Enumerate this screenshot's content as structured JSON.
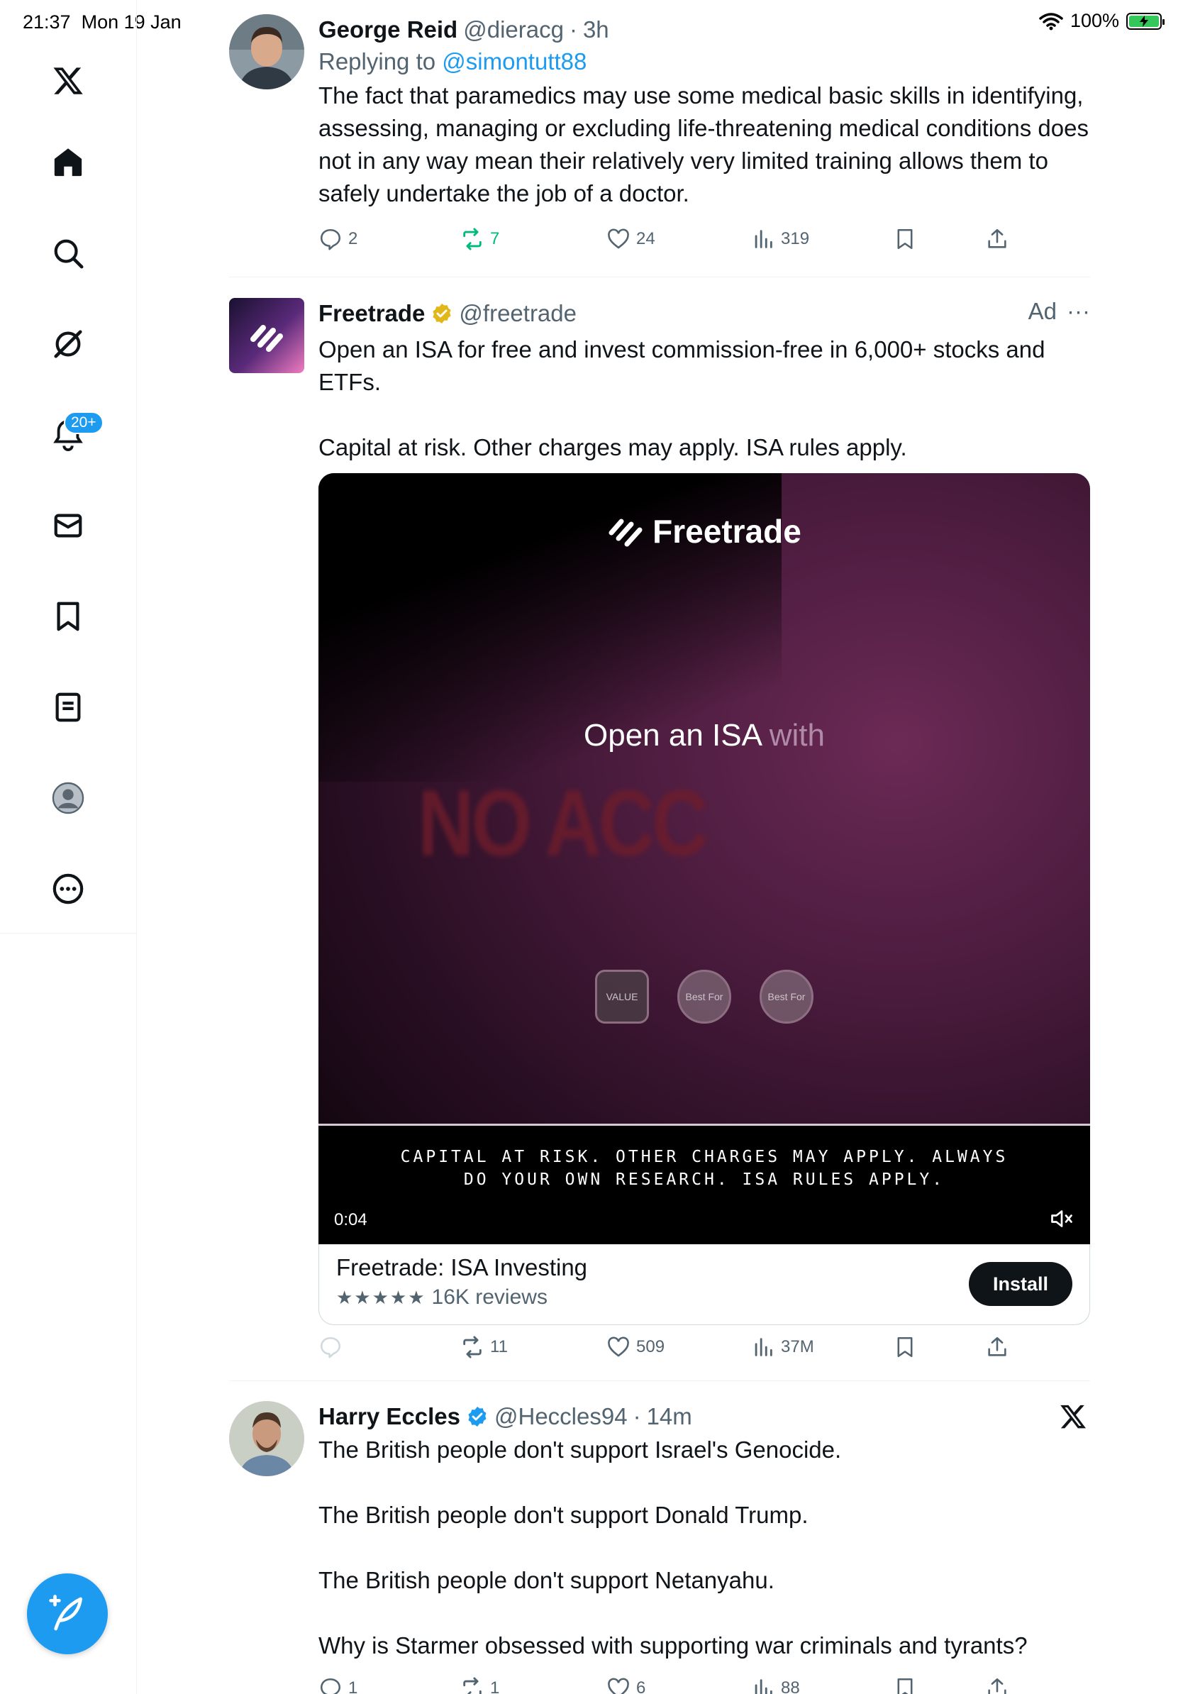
{
  "status_bar": {
    "time": "21:37",
    "date": "Mon 19 Jan",
    "battery": "100%"
  },
  "sidebar": {
    "items": [
      {
        "name": "x-logo"
      },
      {
        "name": "home"
      },
      {
        "name": "search"
      },
      {
        "name": "grok"
      },
      {
        "name": "notifications",
        "badge": "20+"
      },
      {
        "name": "messages"
      },
      {
        "name": "bookmarks"
      },
      {
        "name": "lists"
      },
      {
        "name": "profile"
      },
      {
        "name": "more"
      }
    ]
  },
  "tweets": [
    {
      "name": "George Reid",
      "handle": "@dieracg",
      "time": "3h",
      "reply_prefix": "Replying to",
      "reply_handle": "@simontutt88",
      "text": "The fact that paramedics may use some medical basic skills in identifying, assessing, managing or excluding life-threatening medical conditions does not in any way mean their relatively very limited training allows them to safely undertake the job of a doctor.",
      "stats": {
        "replies": "2",
        "retweets": "7",
        "likes": "24",
        "views": "319"
      }
    },
    {
      "name": "Freetrade",
      "handle": "@freetrade",
      "ad_label": "Ad",
      "more_label": "···",
      "text": "Open an ISA for free and invest commission-free in 6,000+ stocks and ETFs.\n\nCapital at risk. Other charges may apply. ISA rules apply.",
      "video": {
        "logo_text": "Freetrade",
        "tagline_main": "Open an ISA ",
        "tagline_faded": "with",
        "big_text": "NO ACC",
        "badge_labels": [
          "VALUE",
          "Best For",
          "Best For"
        ],
        "disclaimer_line1": "CAPITAL AT RISK. OTHER CHARGES MAY APPLY. ALWAYS",
        "disclaimer_line2": "DO YOUR OWN RESEARCH. ISA RULES APPLY.",
        "time": "0:04"
      },
      "card": {
        "app_name": "Freetrade: ISA Investing",
        "stars": "★★★★★",
        "rating": 4.5,
        "reviews": "16K reviews",
        "install_label": "Install"
      },
      "stats": {
        "retweets": "11",
        "likes": "509",
        "views": "37M"
      }
    },
    {
      "name": "Harry Eccles",
      "handle": "@Heccles94",
      "time": "14m",
      "text": "The British people don't support Israel's Genocide.\n\nThe British people don't support Donald Trump.\n\nThe British people don't support Netanyahu.\n\nWhy is Starmer obsessed with supporting war criminals and tyrants?",
      "stats": {
        "replies": "1",
        "retweets": "1",
        "likes": "6",
        "views": "88"
      }
    }
  ],
  "colors": {
    "accent": "#1d9bf0",
    "retweet": "#00ba7c",
    "gold": "#e2b719"
  }
}
